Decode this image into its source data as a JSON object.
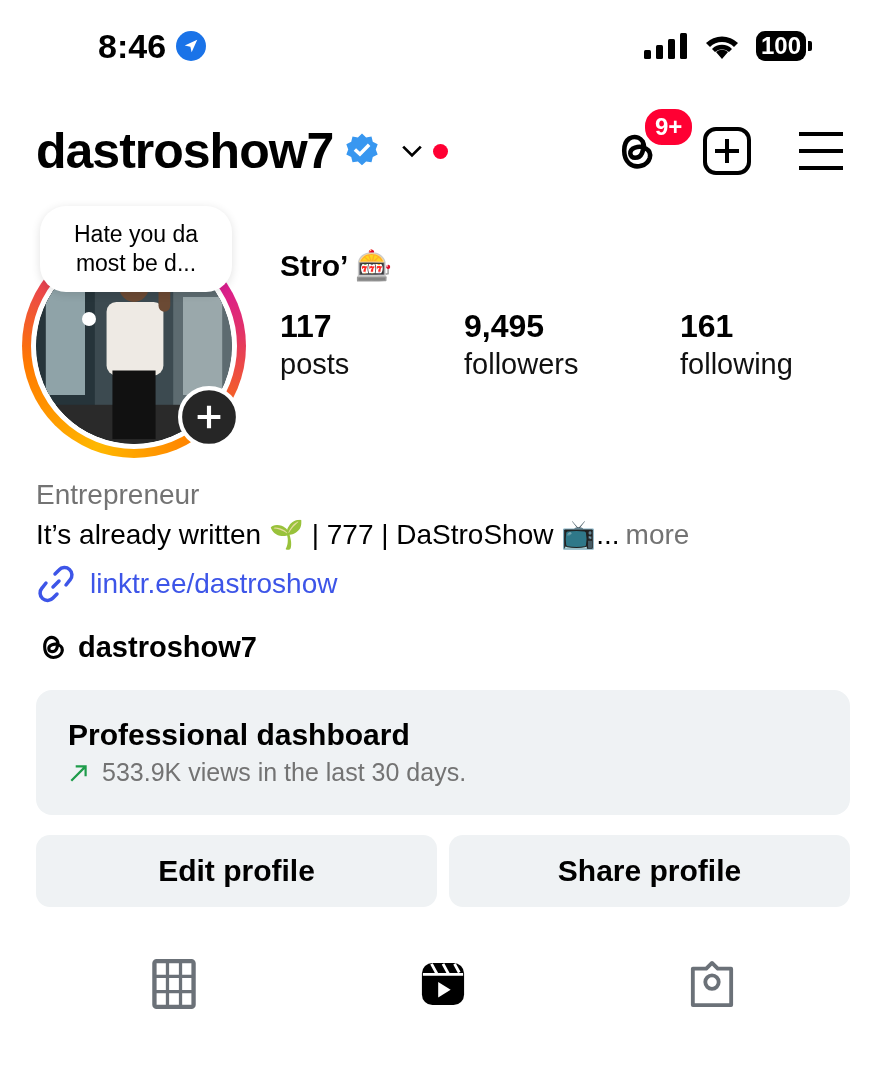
{
  "status_bar": {
    "time": "8:46",
    "battery": "100"
  },
  "header": {
    "username": "dastroshow7",
    "verified": true,
    "notification_dot": true,
    "threads_badge": "9+"
  },
  "profile": {
    "note": "Hate you da most be d...",
    "name": "Stro’ 🎰",
    "stats": [
      {
        "value": "117",
        "label": "posts"
      },
      {
        "value": "9,495",
        "label": "followers"
      },
      {
        "value": "161",
        "label": "following"
      }
    ],
    "category": "Entrepreneur",
    "bio": "It’s already written 🌱 | 777 | DaStroShow 📺...",
    "bio_more": "more",
    "link": "linktr.ee/dastroshow",
    "threads_handle": "dastroshow7"
  },
  "dashboard": {
    "title": "Professional dashboard",
    "subtitle": "533.9K views in the last 30 days."
  },
  "buttons": [
    "Edit profile",
    "Share profile"
  ],
  "tabs": [
    {
      "kind": "grid",
      "selected": false
    },
    {
      "kind": "reels",
      "selected": true
    },
    {
      "kind": "tagged",
      "selected": false
    }
  ]
}
